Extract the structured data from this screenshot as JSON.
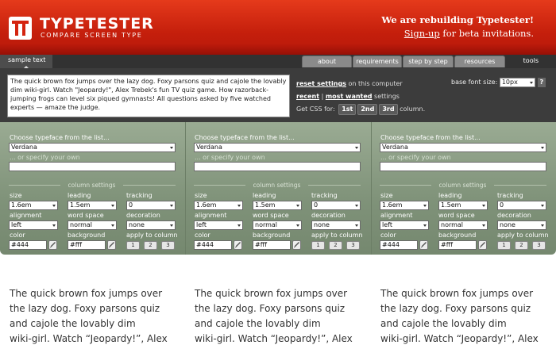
{
  "header": {
    "logo_title": "TYPETESTER",
    "logo_subtitle": "COMPARE SCREEN TYPE",
    "notice_title": "We are rebuilding Typetester!",
    "notice_link": "Sign-up",
    "notice_rest": " for beta invitations.",
    "colors": {
      "bar": "#c51f0c",
      "text": "#ffffff"
    }
  },
  "tabbar": {
    "sample_tab": "sample text",
    "tabs": [
      "about",
      "requirements",
      "step by step",
      "resources"
    ],
    "tools": "tools"
  },
  "panel": {
    "sample_text": "The quick brown fox jumps over the lazy dog. Foxy parsons quiz and cajole the lovably dim wiki-girl. Watch \"Jeopardy!\", Alex Trebek's fun TV quiz game. How razorback-jumping frogs can level six piqued gymnasts! All questions asked by five watched experts — amaze the judge.",
    "reset_link": "reset settings",
    "reset_rest": " on this computer",
    "recent_link": "recent",
    "sep": " | ",
    "most_wanted_link": "most wanted",
    "settings_word": " settings",
    "css_label": "Get CSS for: ",
    "css_buttons": [
      "1st",
      "2nd",
      "3rd"
    ],
    "css_suffix": " column.",
    "base_font_label": "base font size: ",
    "base_font_value": "10px",
    "help": "?"
  },
  "columns": [
    {
      "choose": "Choose typeface from the list...",
      "typeface": "Verdana",
      "specify": "... or specify your own",
      "settings_title": "column settings",
      "size_label": "size",
      "size": "1.6em",
      "leading_label": "leading",
      "leading": "1.5em",
      "tracking_label": "tracking",
      "tracking": "0",
      "alignment_label": "alignment",
      "alignment": "left",
      "wordspace_label": "word space",
      "wordspace": "normal",
      "decoration_label": "decoration",
      "decoration": "none",
      "color_label": "color",
      "color": "#444",
      "background_label": "background",
      "background": "#fff",
      "apply_label": "apply to column",
      "apply": [
        "1",
        "2",
        "3"
      ]
    },
    {
      "choose": "Choose typeface from the list...",
      "typeface": "Verdana",
      "specify": "... or specify your own",
      "settings_title": "column settings",
      "size_label": "size",
      "size": "1.6em",
      "leading_label": "leading",
      "leading": "1.5em",
      "tracking_label": "tracking",
      "tracking": "0",
      "alignment_label": "alignment",
      "alignment": "left",
      "wordspace_label": "word space",
      "wordspace": "normal",
      "decoration_label": "decoration",
      "decoration": "none",
      "color_label": "color",
      "color": "#444",
      "background_label": "background",
      "background": "#fff",
      "apply_label": "apply to column",
      "apply": [
        "1",
        "2",
        "3"
      ]
    },
    {
      "choose": "Choose typeface from the list...",
      "typeface": "Verdana",
      "specify": "... or specify your own",
      "settings_title": "column settings",
      "size_label": "size",
      "size": "1.6em",
      "leading_label": "leading",
      "leading": "1.5em",
      "tracking_label": "tracking",
      "tracking": "0",
      "alignment_label": "alignment",
      "alignment": "left",
      "wordspace_label": "word space",
      "wordspace": "normal",
      "decoration_label": "decoration",
      "decoration": "none",
      "color_label": "color",
      "color": "#444",
      "background_label": "background",
      "background": "#fff",
      "apply_label": "apply to column",
      "apply": [
        "1",
        "2",
        "3"
      ]
    }
  ],
  "preview": {
    "lines": [
      "The quick brown fox jumps over",
      "the lazy dog. Foxy parsons quiz",
      "and cajole the lovably dim",
      "wiki-girl. Watch “Jeopardy!”, Alex"
    ]
  }
}
